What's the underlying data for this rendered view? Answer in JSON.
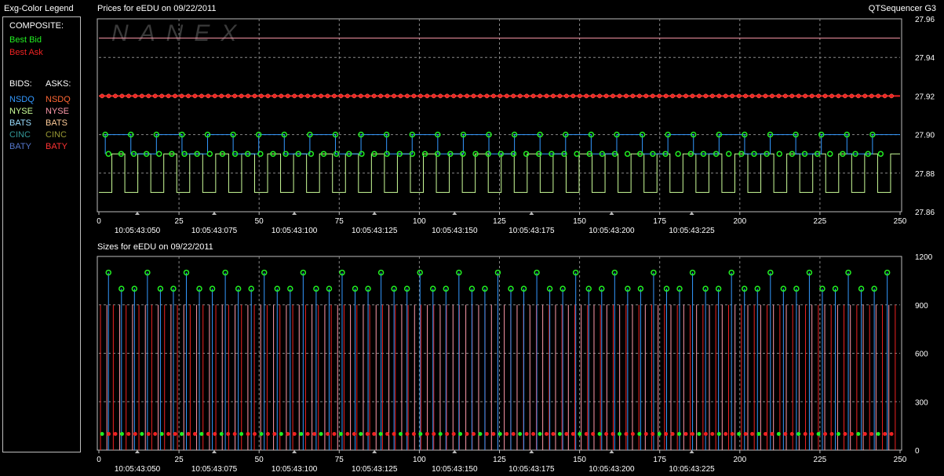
{
  "app_name": "QTSequencer G3",
  "watermark": "NANEX",
  "legend": {
    "title": "Exg-Color Legend",
    "composite_label": "COMPOSITE:",
    "composite": [
      {
        "label": "Best Bid",
        "color": "#22ee22"
      },
      {
        "label": "Best Ask",
        "color": "#ee2222"
      }
    ],
    "bids_label": "BIDS:",
    "asks_label": "ASKS:",
    "bids": [
      {
        "label": "NSDQ",
        "color": "#3399ff"
      },
      {
        "label": "NYSE",
        "color": "#ccff99"
      },
      {
        "label": "BATS",
        "color": "#99ddff"
      },
      {
        "label": "CINC",
        "color": "#339999"
      },
      {
        "label": "BATY",
        "color": "#5577cc"
      }
    ],
    "asks": [
      {
        "label": "NSDQ",
        "color": "#ff6633"
      },
      {
        "label": "NYSE",
        "color": "#ff99aa"
      },
      {
        "label": "BATS",
        "color": "#ffcc99"
      },
      {
        "label": "CINC",
        "color": "#999933"
      },
      {
        "label": "BATY",
        "color": "#ff3333"
      }
    ]
  },
  "chart_data": [
    {
      "type": "line",
      "title": "Prices for  eEDU  on  09/22/2011",
      "x_ticks": [
        "0",
        "25",
        "50",
        "75",
        "100",
        "125",
        "150",
        "175",
        "200",
        "225",
        "250"
      ],
      "time_labels": [
        "10:05:43:050",
        "10:05:43:075",
        "10:05:43:100",
        "10:05:43:125",
        "10:05:43:150",
        "10:05:43:175",
        "10:05:43:200",
        "10:05:43:225"
      ],
      "y_ticks": [
        "27.96",
        "27.94",
        "27.92",
        "27.90",
        "27.88",
        "27.86"
      ],
      "xlim": [
        0,
        250
      ],
      "ylim": [
        27.86,
        27.96
      ],
      "grid": true,
      "series": [
        {
          "name": "Best Ask",
          "color": "#ee2222",
          "constant": 27.92
        },
        {
          "name": "NYSE Ask",
          "color": "#ff99aa",
          "constant": 27.95
        },
        {
          "name": "NSDQ Bid",
          "color": "#3399ff",
          "pattern": [
            27.89,
            27.9
          ]
        },
        {
          "name": "NYSE Bid",
          "color": "#ccff99",
          "pattern": [
            27.87,
            27.88,
            27.89
          ]
        },
        {
          "name": "Best Bid",
          "color": "#22ee22",
          "pattern": [
            27.89,
            27.9
          ]
        }
      ]
    },
    {
      "type": "line",
      "title": "Sizes for  eEDU  on  09/22/2011",
      "x_ticks": [
        "0",
        "25",
        "50",
        "75",
        "100",
        "125",
        "150",
        "175",
        "200",
        "225",
        "250"
      ],
      "time_labels": [
        "10:05:43:050",
        "10:05:43:075",
        "10:05:43:100",
        "10:05:43:125",
        "10:05:43:150",
        "10:05:43:175",
        "10:05:43:200",
        "10:05:43:225"
      ],
      "y_ticks": [
        "1200",
        "900",
        "600",
        "300",
        "0"
      ],
      "xlim": [
        0,
        250
      ],
      "ylim": [
        0,
        1200
      ],
      "grid": true,
      "series": [
        {
          "name": "Best Bid size",
          "color": "#22ee22",
          "pattern": [
            1100,
            1000,
            100
          ]
        },
        {
          "name": "Best Ask size",
          "color": "#ee2222",
          "constant": 100
        },
        {
          "name": "NYSE Ask size",
          "color": "#ff99aa",
          "constant": 900
        },
        {
          "name": "NSDQ Bid size",
          "color": "#3399ff",
          "pattern": [
            1100,
            1000
          ]
        }
      ]
    }
  ]
}
